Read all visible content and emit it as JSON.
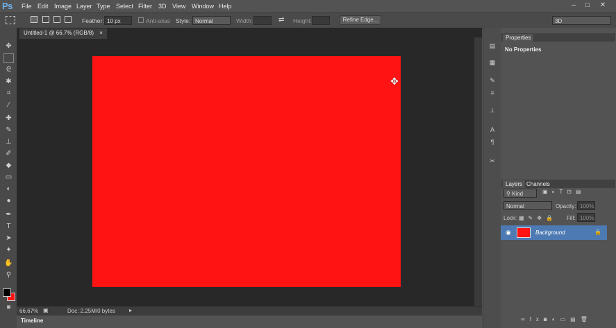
{
  "app": {
    "logo": "Ps"
  },
  "menu": [
    "File",
    "Edit",
    "Image",
    "Layer",
    "Type",
    "Select",
    "Filter",
    "3D",
    "View",
    "Window",
    "Help"
  ],
  "window_controls": {
    "minimize": "–",
    "restore": "□",
    "close": "✕"
  },
  "options": {
    "feather_label": "Feather:",
    "feather_value": "10 px",
    "antialias_label": "Anti-alias",
    "style_label": "Style:",
    "style_value": "Normal",
    "width_label": "Width:",
    "height_label": "Height:",
    "refine_edge": "Refine Edge...",
    "workspace": "3D"
  },
  "document": {
    "tab_title": "Untitled-1 @ 66.7% (RGB/8)",
    "tab_close": "×",
    "zoom": "66.67%",
    "doc_info": "Doc: 2.25M/0 bytes",
    "canvas_color": "#ff1313"
  },
  "timeline": {
    "label": "Timeline"
  },
  "properties": {
    "tab": "Properties",
    "message": "No Properties"
  },
  "layers_panel": {
    "tabs": [
      "Layers",
      "Channels"
    ],
    "kind_label": "Kind",
    "blend_mode": "Normal",
    "opacity_label": "Opacity:",
    "opacity_value": "100%",
    "lock_label": "Lock:",
    "fill_label": "Fill:",
    "fill_value": "100%",
    "layers": [
      {
        "name": "Background",
        "color": "#ff1313",
        "locked": true,
        "visible": true
      }
    ]
  },
  "colors": {
    "fg": "#000000",
    "bg": "#ff1313",
    "selected_layer": "#4d7ab3"
  }
}
